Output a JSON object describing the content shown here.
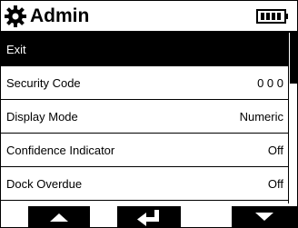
{
  "header": {
    "title": "Admin",
    "icon": "gear-icon",
    "battery_icon": "battery-icon"
  },
  "menu": {
    "items": [
      {
        "label": "Exit",
        "value": "",
        "selected": true
      },
      {
        "label": "Security Code",
        "value": "0 0 0"
      },
      {
        "label": "Display Mode",
        "value": "Numeric"
      },
      {
        "label": "Confidence Indicator",
        "value": "Off"
      },
      {
        "label": "Dock Overdue",
        "value": "Off"
      }
    ]
  },
  "softkeys": {
    "left": "up-arrow-icon",
    "center": "enter-icon",
    "right": "down-arrow-icon"
  }
}
